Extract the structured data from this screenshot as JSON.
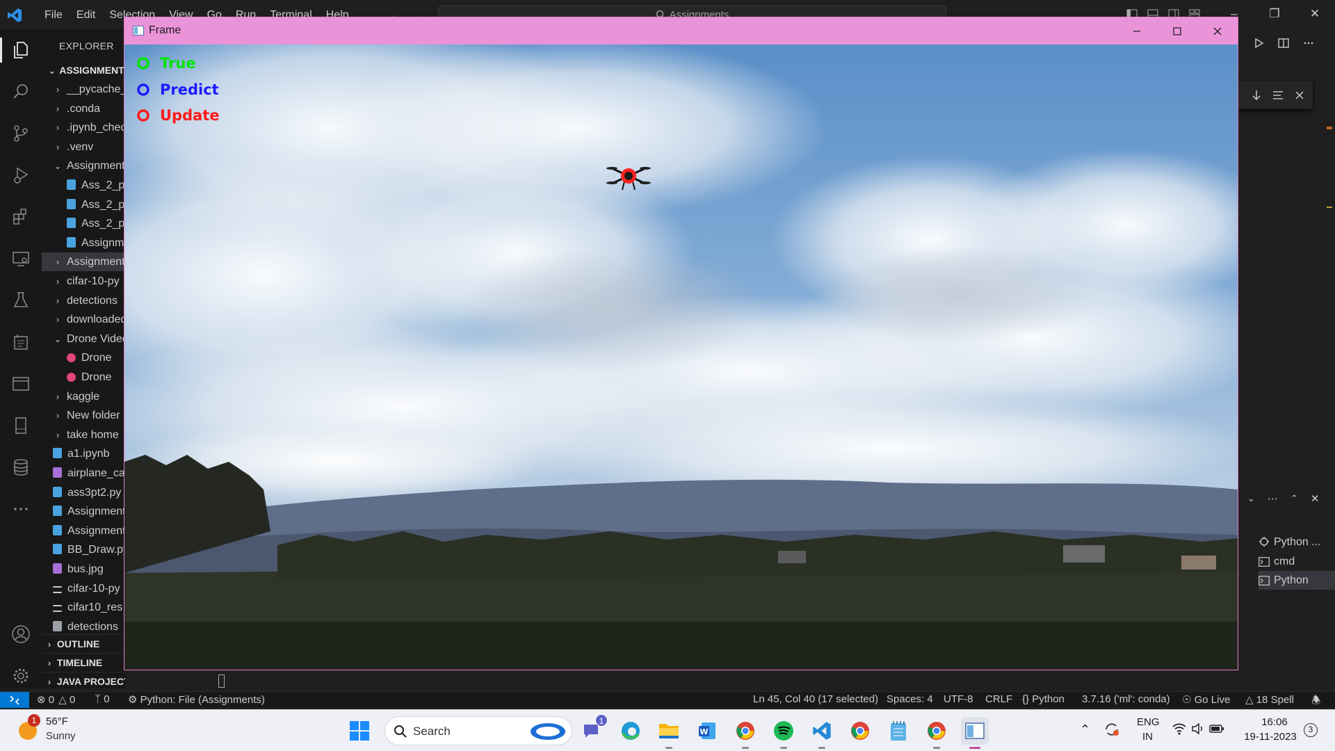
{
  "titlebar": {
    "menu": [
      "File",
      "Edit",
      "Selection",
      "View",
      "Go",
      "Run",
      "Terminal",
      "Help"
    ],
    "search_text": "Assignments"
  },
  "sidebar": {
    "title": "EXPLORER",
    "root": "ASSIGNMENTS",
    "items": [
      {
        "label": "__pycache__",
        "kind": "folder",
        "open": false,
        "level": 1
      },
      {
        "label": ".conda",
        "kind": "folder",
        "open": false,
        "level": 1
      },
      {
        "label": ".ipynb_checkpoints",
        "kind": "folder",
        "open": false,
        "level": 1
      },
      {
        "label": ".venv",
        "kind": "folder",
        "open": false,
        "level": 1
      },
      {
        "label": "Assignment",
        "kind": "folder",
        "open": true,
        "level": 1
      },
      {
        "label": "Ass_2_p",
        "kind": "notebook",
        "level": 2
      },
      {
        "label": "Ass_2_p",
        "kind": "notebook",
        "level": 2
      },
      {
        "label": "Ass_2_p",
        "kind": "notebook",
        "level": 2
      },
      {
        "label": "Assignm",
        "kind": "notebook",
        "level": 2
      },
      {
        "label": "Assignment",
        "kind": "folder",
        "open": false,
        "level": 1,
        "selected": true
      },
      {
        "label": "cifar-10-py",
        "kind": "folder",
        "open": false,
        "level": 1
      },
      {
        "label": "detections",
        "kind": "folder",
        "open": false,
        "level": 1
      },
      {
        "label": "downloaded",
        "kind": "folder",
        "open": false,
        "level": 1
      },
      {
        "label": "Drone Video",
        "kind": "folder",
        "open": true,
        "level": 1
      },
      {
        "label": "Drone",
        "kind": "video",
        "level": 2
      },
      {
        "label": "Drone",
        "kind": "video",
        "level": 2
      },
      {
        "label": "kaggle",
        "kind": "folder",
        "open": false,
        "level": 1
      },
      {
        "label": "New folder",
        "kind": "folder",
        "open": false,
        "level": 1
      },
      {
        "label": "take home",
        "kind": "folder",
        "open": false,
        "level": 1
      },
      {
        "label": "a1.ipynb",
        "kind": "notebook",
        "level": 1
      },
      {
        "label": "airplane_ca",
        "kind": "image",
        "level": 1
      },
      {
        "label": "ass3pt2.py",
        "kind": "python",
        "level": 1
      },
      {
        "label": "Assignment",
        "kind": "notebook",
        "level": 1
      },
      {
        "label": "Assignment",
        "kind": "python",
        "level": 1
      },
      {
        "label": "BB_Draw.py",
        "kind": "python",
        "level": 1
      },
      {
        "label": "bus.jpg",
        "kind": "image",
        "level": 1
      },
      {
        "label": "cifar-10-py",
        "kind": "text",
        "level": 1
      },
      {
        "label": "cifar10_res",
        "kind": "text",
        "level": 1
      },
      {
        "label": "detections",
        "kind": "file",
        "level": 1
      }
    ],
    "sections": [
      "OUTLINE",
      "TIMELINE",
      "JAVA PROJECTS"
    ]
  },
  "terminals": [
    {
      "label": "Python ...",
      "icon": "debug-icon",
      "selected": false
    },
    {
      "label": "cmd",
      "icon": "terminal-icon",
      "selected": false
    },
    {
      "label": "Python",
      "icon": "terminal-icon",
      "selected": true
    }
  ],
  "frame_window": {
    "title": "Frame",
    "legend": [
      {
        "label": "True",
        "color": "#00e600"
      },
      {
        "label": "Predict",
        "color": "#1a1aff"
      },
      {
        "label": "Update",
        "color": "#ff1a1a"
      }
    ]
  },
  "statusbar": {
    "errors": "0",
    "warnings": "0",
    "ports": "0",
    "run_config": "Python: File (Assignments)",
    "cursor": "Ln 45, Col 40 (17 selected)",
    "spaces": "Spaces: 4",
    "encoding": "UTF-8",
    "eol": "CRLF",
    "language": "Python",
    "interpreter": "3.7.16 ('ml': conda)",
    "golive": "Go Live",
    "spell": "18 Spell"
  },
  "taskbar": {
    "weather_temp": "56°F",
    "weather_cond": "Sunny",
    "weather_badge": "1",
    "search_label": "Search",
    "teams_badge": "1",
    "lang_top": "ENG",
    "lang_bottom": "IN",
    "time": "16:06",
    "date": "19-11-2023",
    "notif_count": "3"
  }
}
